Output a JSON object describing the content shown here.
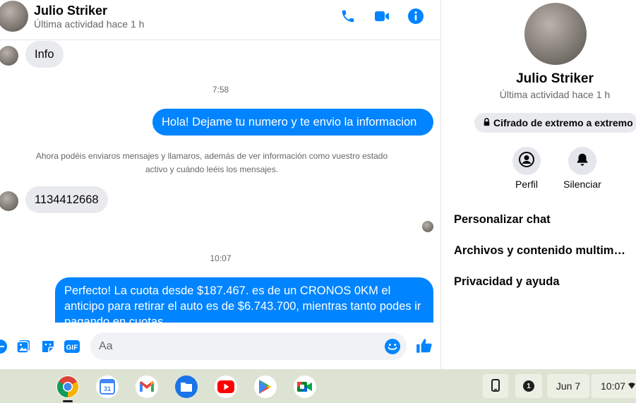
{
  "header": {
    "name": "Julio Striker",
    "status": "Última actividad hace 1 h",
    "icons": [
      "phone-icon",
      "video-icon",
      "info-icon"
    ]
  },
  "messages": {
    "info_bubble": "Info",
    "time_1": "7:58",
    "outgoing_1": "Hola! Dejame tu numero y te envio la informacion",
    "system_notice": "Ahora podéis enviaros mensajes y llamaros, además de ver información como vuestro estado activo y cuándo leéis los mensajes.",
    "number_bubble": "1134412668",
    "time_2": "10:07",
    "outgoing_2": "Perfecto! La cuota desde $187.467. es de un CRONOS 0KM el anticipo para retirar el auto es de $6.743.700, mientras tanto podes ir pagando en cuotas"
  },
  "composer": {
    "placeholder": "Aa",
    "gif_label": "GIF"
  },
  "info_pane": {
    "name": "Julio Striker",
    "status": "Última actividad hace 1 h",
    "e2e_label": "Cifrado de extremo a extremo",
    "profile_label": "Perfil",
    "mute_label": "Silenciar",
    "menu": [
      "Personalizar chat",
      "Archivos y contenido multimedia",
      "Privacidad y ayuda"
    ]
  },
  "shelf": {
    "notification_count": "1",
    "date": "Jun 7",
    "time": "10:07"
  },
  "colors": {
    "accent": "#0084ff",
    "bubble_in": "#e9eaee",
    "shelf_bg": "#dde3d3"
  }
}
